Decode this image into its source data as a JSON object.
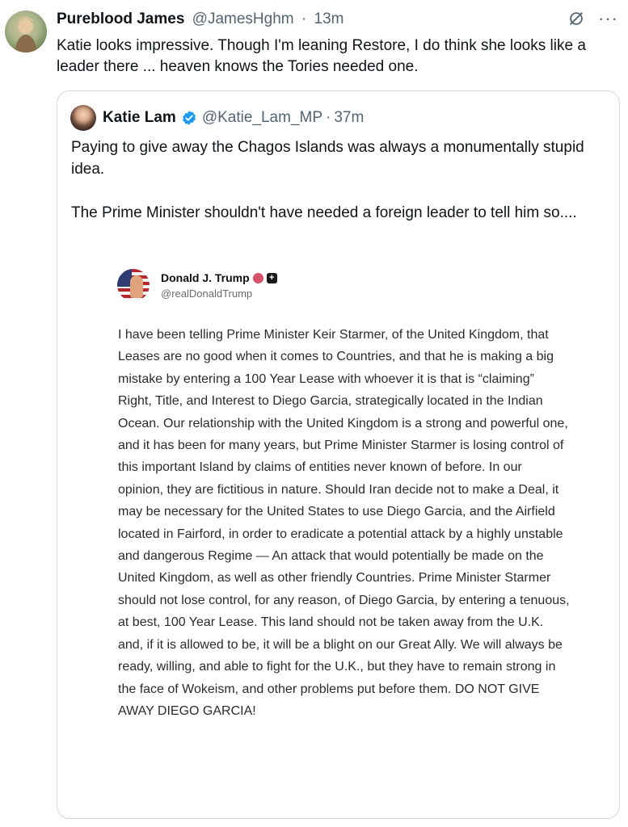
{
  "post": {
    "author_name": "Pureblood James",
    "author_handle": "@JamesHghm",
    "separator": "·",
    "time": "13m",
    "text": "Katie looks impressive. Though I'm leaning Restore, I do think she looks like a leader there ... heaven knows the Tories needed one.",
    "more_label": "···"
  },
  "quote": {
    "author_name": "Katie Lam",
    "author_handle": "@Katie_Lam_MP",
    "separator": "·",
    "time": "37m",
    "paragraph_1": "Paying to give away the Chagos Islands was always a monumentally stupid idea.",
    "paragraph_2": "The Prime Minister shouldn't have needed a foreign leader to tell him so....",
    "verified_color": "#1d9bf0"
  },
  "embedded_post": {
    "author_name": "Donald J. Trump",
    "author_handle": "@realDonaldTrump",
    "plus_badge": "+",
    "body": "I have been telling Prime Minister Keir Starmer, of the United Kingdom, that Leases are no good when it comes to Countries, and that he is making a big mistake by entering a 100 Year Lease with whoever it is that is “claiming” Right, Title, and Interest to Diego Garcia, strategically located in the Indian Ocean. Our relationship with the United Kingdom is a strong and powerful one, and it has been for many years, but Prime Minister Starmer is losing control of this important Island by claims of entities never known of before. In our opinion, they are fictitious in nature. Should Iran decide not to make a Deal, it may be necessary for the United States to use Diego Garcia, and the Airfield located in Fairford, in order to eradicate a potential attack by a highly unstable and dangerous Regime — An attack that would potentially be made on the United Kingdom, as well as other friendly Countries. Prime Minister Starmer should not lose control, for any reason, of Diego Garcia, by entering a tenuous, at best, 100 Year Lease. This land should not be taken away from the U.K. and, if it is allowed to be, it will be a blight on our Great Ally. We will always be ready, willing, and able to fight for the U.K., but they have to remain strong in the face of Wokeism, and other problems put before them. DO NOT GIVE AWAY DIEGO GARCIA!"
  },
  "icons": {
    "avatar": "avatar-icon",
    "grok": "grok-icon",
    "more": "more-icon",
    "verified": "verified-badge-icon"
  }
}
